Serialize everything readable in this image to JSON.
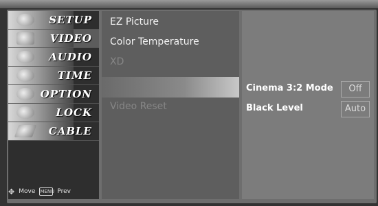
{
  "menu": {
    "items": [
      {
        "label": "SETUP",
        "icon": "setup-icon"
      },
      {
        "label": "VIDEO",
        "icon": "video-icon"
      },
      {
        "label": "AUDIO",
        "icon": "audio-icon"
      },
      {
        "label": "TIME",
        "icon": "time-icon"
      },
      {
        "label": "OPTION",
        "icon": "option-icon"
      },
      {
        "label": "LOCK",
        "icon": "lock-icon"
      },
      {
        "label": "CABLE",
        "icon": "cable-icon"
      }
    ],
    "active_index": 1,
    "footer": {
      "move_label": "Move",
      "prev_key": "MENU",
      "prev_label": "Prev"
    }
  },
  "submenu": {
    "items": [
      {
        "label": "EZ Picture",
        "state": "normal"
      },
      {
        "label": "Color Temperature",
        "state": "normal"
      },
      {
        "label": "XD",
        "state": "dim"
      },
      {
        "label": "",
        "state": "selected"
      },
      {
        "label": "Video Reset",
        "state": "dim"
      }
    ]
  },
  "options": {
    "cinema": {
      "label": "Cinema 3:2 Mode",
      "value": "Off"
    },
    "black_level": {
      "label": "Black Level",
      "value": "Auto"
    }
  }
}
